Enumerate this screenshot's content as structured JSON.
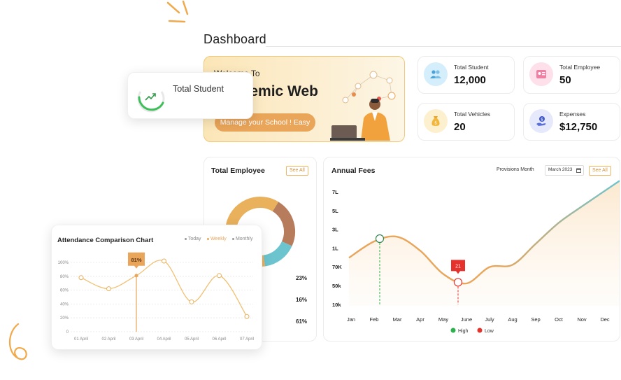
{
  "header": {
    "title": "Dashboard"
  },
  "welcome": {
    "greeting": "Welcome To",
    "headline": "Academic Web",
    "button_label": "Manage your School ! Easy"
  },
  "stats": [
    {
      "label": "Total Student",
      "value": "12,000",
      "icon": "students-icon",
      "color": "#d5eefc"
    },
    {
      "label": "Total Employee",
      "value": "50",
      "icon": "id-card-icon",
      "color": "#fde0ea"
    },
    {
      "label": "Total Vehicles",
      "value": "20",
      "icon": "money-bag-icon",
      "color": "#fdf0cf"
    },
    {
      "label": "Expenses",
      "value": "$12,750",
      "icon": "hand-coin-icon",
      "color": "#e6e9fb"
    }
  ],
  "floating_badge": {
    "label": "Total Student",
    "icon": "trend-up-icon"
  },
  "employee_card": {
    "title": "Total Employee",
    "see_all": "See All",
    "percents": [
      "23%",
      "16%",
      "61%"
    ]
  },
  "fees_card": {
    "title": "Annual Fees",
    "provision_label": "Provisions Month",
    "month_value": "March 2023",
    "see_all": "See All",
    "low_marker": "21",
    "legend": [
      "High",
      "Low"
    ]
  },
  "attendance_card": {
    "title": "Attendance Comparison Chart",
    "tabs": [
      "Today",
      "Weekly",
      "Monthly"
    ],
    "marker_label": "81%"
  },
  "colors": {
    "accent": "#e9a55a",
    "teal": "#6cc4cf",
    "brown": "#b77c5c",
    "high": "#2bb24c",
    "low": "#e5322c"
  },
  "chart_data": [
    {
      "type": "pie",
      "title": "Total Employee",
      "values": [
        23,
        16,
        61
      ],
      "labels": [
        "23%",
        "16%",
        "61%"
      ],
      "colors": [
        "#b77c5c",
        "#6cc4cf",
        "#e9b15c"
      ]
    },
    {
      "type": "line",
      "title": "Annual Fees",
      "categories": [
        "Jan",
        "Feb",
        "Mar",
        "Apr",
        "May",
        "June",
        "July",
        "Aug",
        "Sep",
        "Oct",
        "Nov",
        "Dec"
      ],
      "y_ticks": [
        "7L",
        "5L",
        "3L",
        "1L",
        "70K",
        "50k",
        "10k"
      ],
      "series": [
        {
          "values": [
            2.0,
            2.7,
            2.9,
            2.3,
            1.3,
            0.9,
            1.6,
            1.7,
            2.6,
            3.5,
            4.2,
            5.3
          ]
        }
      ],
      "annotations": [
        {
          "x": "Feb",
          "label": "High",
          "color": "#2bb24c"
        },
        {
          "x": "June",
          "label": "21",
          "color": "#e5322c"
        }
      ],
      "ylim": [
        0,
        6
      ]
    },
    {
      "type": "line",
      "title": "Attendance Comparison Chart",
      "categories": [
        "01 April",
        "02 April",
        "03 April",
        "04 April",
        "05 April",
        "06 April",
        "07 April"
      ],
      "y_ticks": [
        "100%",
        "80%",
        "60%",
        "40%",
        "20%",
        "0"
      ],
      "series": [
        {
          "values": [
            78,
            62,
            81,
            102,
            43,
            81,
            22
          ]
        }
      ],
      "ylim": [
        0,
        100
      ],
      "highlight": {
        "x": "03 April",
        "value": 81
      }
    }
  ]
}
